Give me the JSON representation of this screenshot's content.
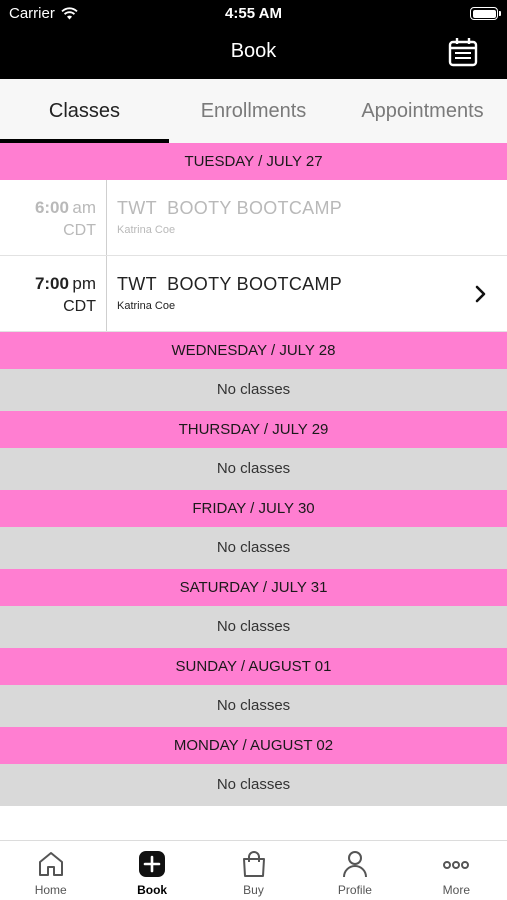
{
  "status_bar": {
    "carrier": "Carrier",
    "time": "4:55 AM"
  },
  "nav": {
    "title": "Book"
  },
  "tabs": [
    {
      "label": "Classes",
      "active": true
    },
    {
      "label": "Enrollments",
      "active": false
    },
    {
      "label": "Appointments",
      "active": false
    }
  ],
  "schedule": {
    "days": [
      {
        "header": "TUESDAY / JULY 27",
        "classes": [
          {
            "time": "6:00",
            "ampm": "am",
            "tz": "CDT",
            "name": "TWT  BOOTY BOOTCAMP",
            "instructor": "Katrina Coe",
            "past": true
          },
          {
            "time": "7:00",
            "ampm": "pm",
            "tz": "CDT",
            "name": "TWT  BOOTY BOOTCAMP",
            "instructor": "Katrina Coe",
            "past": false
          }
        ]
      },
      {
        "header": "WEDNESDAY / JULY 28",
        "empty_text": "No classes"
      },
      {
        "header": "THURSDAY / JULY 29",
        "empty_text": "No classes"
      },
      {
        "header": "FRIDAY / JULY 30",
        "empty_text": "No classes"
      },
      {
        "header": "SATURDAY / JULY 31",
        "empty_text": "No classes"
      },
      {
        "header": "SUNDAY / AUGUST 01",
        "empty_text": "No classes"
      },
      {
        "header": "MONDAY / AUGUST 02",
        "empty_text": "No classes"
      }
    ]
  },
  "tab_bar": [
    {
      "label": "Home",
      "icon": "home-icon"
    },
    {
      "label": "Book",
      "icon": "plus-square-icon",
      "active": true
    },
    {
      "label": "Buy",
      "icon": "shopping-bag-icon"
    },
    {
      "label": "Profile",
      "icon": "person-icon"
    },
    {
      "label": "More",
      "icon": "more-dots-icon"
    }
  ],
  "colors": {
    "day_header": "#ff7ed1",
    "no_classes_bg": "#d9d9d9",
    "top_bar": "#000000"
  }
}
